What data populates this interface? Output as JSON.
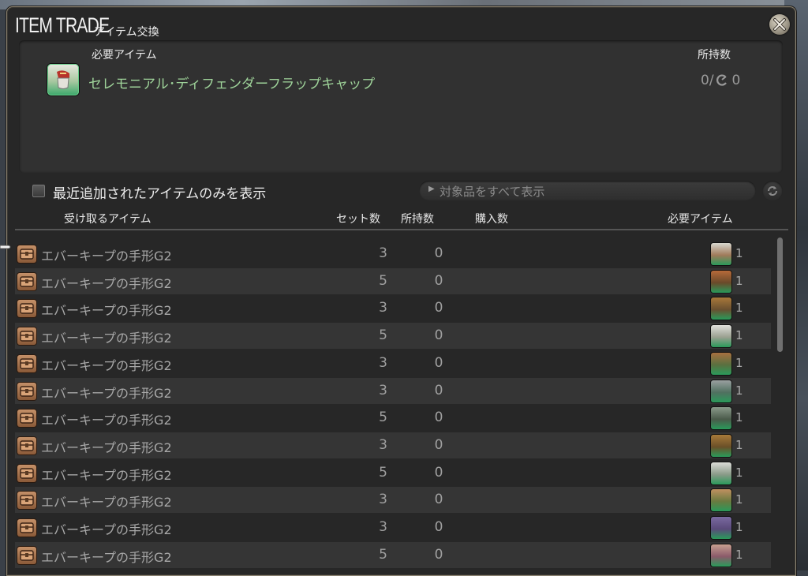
{
  "window": {
    "title": "ITEM TRADE",
    "subtitle": "アイテム交換"
  },
  "required": {
    "label": "必要アイテム",
    "owned_label": "所持数",
    "item_name": "セレモニアル･ディフェンダーフラップキャップ",
    "owned": "0/",
    "owned_hq": "0"
  },
  "filter": {
    "recent_only_label": "最近追加されたアイテムのみを表示",
    "show_all_label": "対象品をすべて表示"
  },
  "columns": {
    "receive": "受け取るアイテム",
    "sets": "セット数",
    "owned": "所持数",
    "buy": "購入数",
    "required": "必要アイテム"
  },
  "rows": [
    {
      "name": "エバーキープの手形G2",
      "sets": "3",
      "owned": "0",
      "req_count": "1"
    },
    {
      "name": "エバーキープの手形G2",
      "sets": "5",
      "owned": "0",
      "req_count": "1"
    },
    {
      "name": "エバーキープの手形G2",
      "sets": "3",
      "owned": "0",
      "req_count": "1"
    },
    {
      "name": "エバーキープの手形G2",
      "sets": "5",
      "owned": "0",
      "req_count": "1"
    },
    {
      "name": "エバーキープの手形G2",
      "sets": "3",
      "owned": "0",
      "req_count": "1"
    },
    {
      "name": "エバーキープの手形G2",
      "sets": "3",
      "owned": "0",
      "req_count": "1"
    },
    {
      "name": "エバーキープの手形G2",
      "sets": "5",
      "owned": "0",
      "req_count": "1"
    },
    {
      "name": "エバーキープの手形G2",
      "sets": "3",
      "owned": "0",
      "req_count": "1"
    },
    {
      "name": "エバーキープの手形G2",
      "sets": "5",
      "owned": "0",
      "req_count": "1"
    },
    {
      "name": "エバーキープの手形G2",
      "sets": "3",
      "owned": "0",
      "req_count": "1"
    },
    {
      "name": "エバーキープの手形G2",
      "sets": "3",
      "owned": "0",
      "req_count": "1"
    },
    {
      "name": "エバーキープの手形G2",
      "sets": "5",
      "owned": "0",
      "req_count": "1"
    }
  ],
  "colors": {
    "required_name": "#9fd49a",
    "window_bg": "#272727",
    "frame": "#8d8472"
  }
}
